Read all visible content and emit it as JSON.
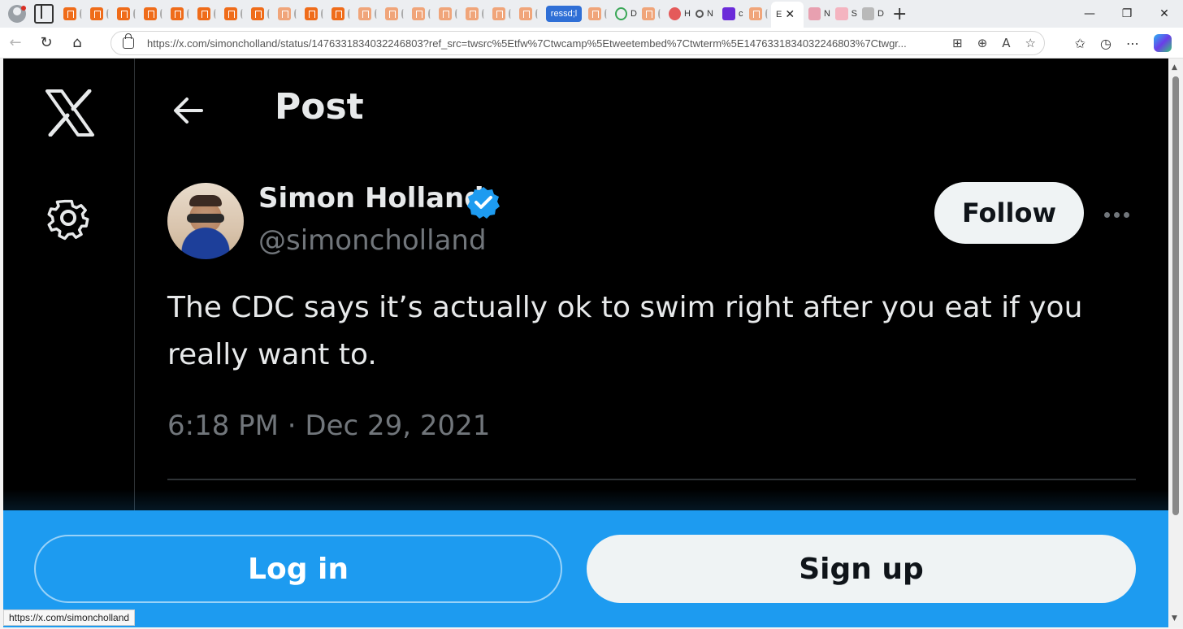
{
  "browser": {
    "active_tab_letter": "E",
    "pill_tab_label": "ressd;l",
    "tab_letters": [
      "D",
      "H",
      "N",
      "c",
      "E",
      "N",
      "S",
      "D"
    ],
    "url": "https://x.com/simoncholland/status/1476331834032246803?ref_src=twsrc%5Etfw%7Ctwcamp%5Etweetembed%7Ctwterm%5E1476331834032246803%7Ctwgr...",
    "status_url": "https://x.com/simoncholland"
  },
  "page": {
    "header_title": "Post",
    "author": {
      "display_name": "Simon Holland",
      "handle": "@simoncholland",
      "verified": true
    },
    "follow_label": "Follow",
    "tweet_text": "The CDC says it’s actually ok to swim right after you eat if you really want to.",
    "timestamp": "6:18 PM · Dec 29, 2021",
    "login_label": "Log in",
    "signup_label": "Sign up"
  },
  "colors": {
    "background": "#000000",
    "accent_blue": "#1d9bf0",
    "text_primary": "#e7e9ea",
    "text_secondary": "#71767b",
    "button_light": "#eff3f4"
  },
  "icons": {
    "logo": "x-logo-icon",
    "settings": "gear-icon",
    "back": "back-arrow-icon",
    "verified": "verified-badge-icon",
    "more": "more-dots-icon"
  }
}
